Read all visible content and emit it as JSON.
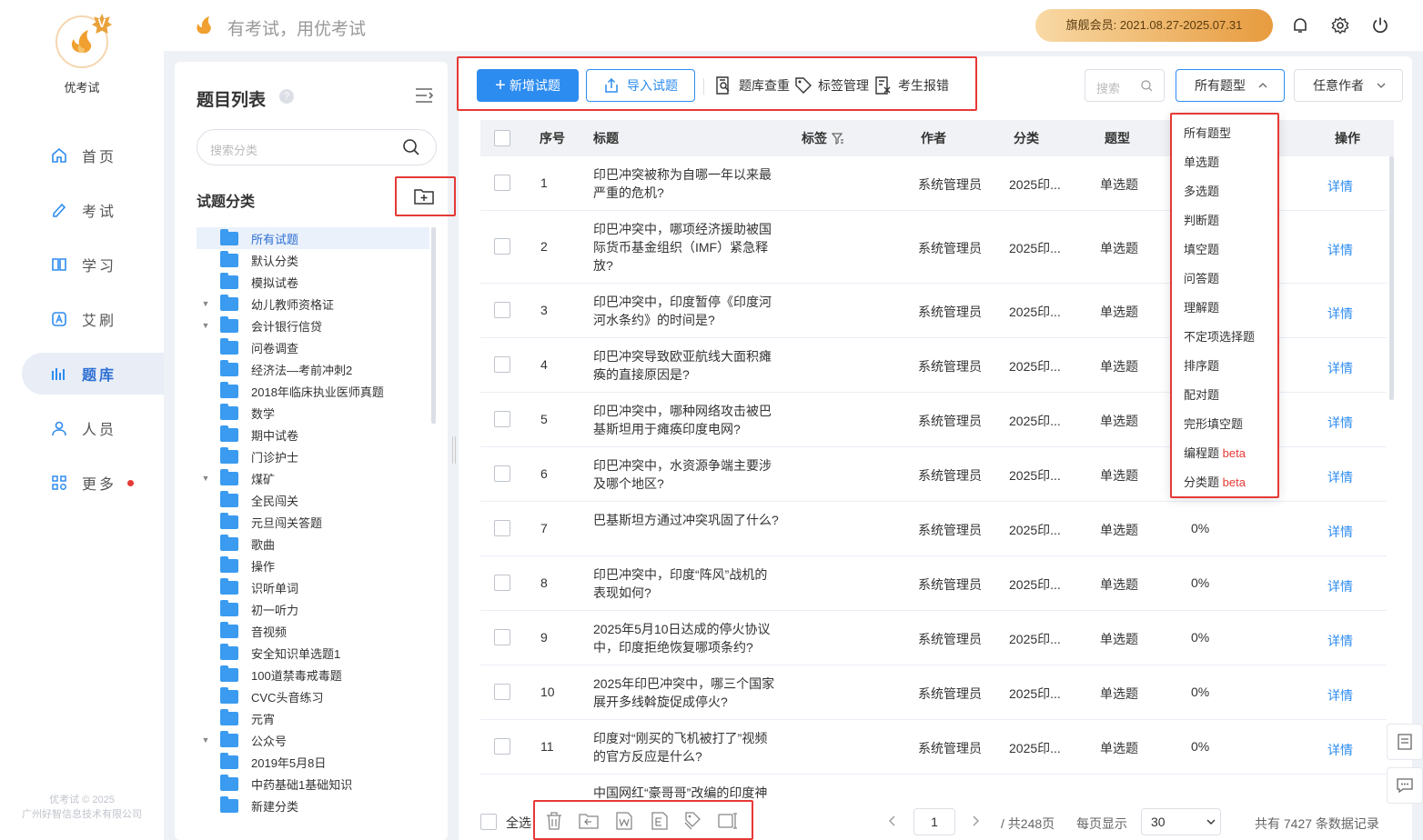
{
  "brand": {
    "name": "优考试",
    "slogan": "有考试，用优考试",
    "badge": "V"
  },
  "header": {
    "member_label": "旗舰会员:  2021.08.27-2025.07.31"
  },
  "nav": {
    "items": [
      {
        "label": "首页",
        "icon": "home-icon"
      },
      {
        "label": "考试",
        "icon": "exam-icon"
      },
      {
        "label": "学习",
        "icon": "book-icon"
      },
      {
        "label": "艾刷",
        "icon": "practice-icon"
      },
      {
        "label": "题库",
        "icon": "question-bank-icon",
        "active": true
      },
      {
        "label": "人员",
        "icon": "user-icon"
      },
      {
        "label": "更多",
        "icon": "more-icon"
      }
    ],
    "copyright_line1": "优考试 © 2025",
    "copyright_line2": "广州好智信息技术有限公司"
  },
  "sidebar": {
    "title": "题目列表",
    "help": "?",
    "search_placeholder": "搜索分类",
    "category_title": "试题分类",
    "tree": [
      {
        "label": "所有试题",
        "selected": true
      },
      {
        "label": "默认分类"
      },
      {
        "label": "模拟试卷"
      },
      {
        "label": "幼儿教师资格证",
        "expandable": true
      },
      {
        "label": "会计银行信贷",
        "expandable": true
      },
      {
        "label": "问卷调查"
      },
      {
        "label": "经济法—考前冲刺2"
      },
      {
        "label": "2018年临床执业医师真题"
      },
      {
        "label": "数学"
      },
      {
        "label": "期中试卷"
      },
      {
        "label": "门诊护士"
      },
      {
        "label": "煤矿",
        "expandable": true
      },
      {
        "label": "全民闯关"
      },
      {
        "label": "元旦闯关答题"
      },
      {
        "label": "歌曲"
      },
      {
        "label": "操作"
      },
      {
        "label": "识听单词"
      },
      {
        "label": "初一听力"
      },
      {
        "label": "音视频"
      },
      {
        "label": "安全知识单选题1"
      },
      {
        "label": "100道禁毒戒毒题"
      },
      {
        "label": "CVC头音练习"
      },
      {
        "label": "元宵"
      },
      {
        "label": "公众号",
        "expandable": true
      },
      {
        "label": "2019年5月8日"
      },
      {
        "label": "中药基础1基础知识"
      },
      {
        "label": "新建分类"
      }
    ]
  },
  "toolbar": {
    "add_label": "新增试题",
    "import_label": "导入试题",
    "dedupe_label": "题库查重",
    "tags_label": "标签管理",
    "errors_label": "考生报错",
    "search_placeholder": "搜索",
    "type_select": "所有题型",
    "author_select": "任意作者"
  },
  "table": {
    "headers": {
      "index": "序号",
      "title": "标题",
      "tags": "标签",
      "author": "作者",
      "category": "分类",
      "type": "题型",
      "action": "操作"
    },
    "rows": [
      {
        "index": "1",
        "title": "印巴冲突被称为自哪一年以来最严重的危机?",
        "author": "系统管理员",
        "category": "2025印...",
        "type": "单选题",
        "rate": "",
        "action": "详情"
      },
      {
        "index": "2",
        "title": "印巴冲突中，哪项经济援助被国际货币基金组织（IMF）紧急释放?",
        "author": "系统管理员",
        "category": "2025印...",
        "type": "单选题",
        "rate": "",
        "action": "详情"
      },
      {
        "index": "3",
        "title": "印巴冲突中，印度暂停《印度河河水条约》的时间是?",
        "author": "系统管理员",
        "category": "2025印...",
        "type": "单选题",
        "rate": "",
        "action": "详情"
      },
      {
        "index": "4",
        "title": "印巴冲突导致欧亚航线大面积瘫痪的直接原因是?",
        "author": "系统管理员",
        "category": "2025印...",
        "type": "单选题",
        "rate": "",
        "action": "详情"
      },
      {
        "index": "5",
        "title": "印巴冲突中，哪种网络攻击被巴基斯坦用于瘫痪印度电网?",
        "author": "系统管理员",
        "category": "2025印...",
        "type": "单选题",
        "rate": "",
        "action": "详情"
      },
      {
        "index": "6",
        "title": "印巴冲突中，水资源争端主要涉及哪个地区?",
        "author": "系统管理员",
        "category": "2025印...",
        "type": "单选题",
        "rate": "",
        "action": "详情"
      },
      {
        "index": "7",
        "title": "巴基斯坦方通过冲突巩固了什么?",
        "author": "系统管理员",
        "category": "2025印...",
        "type": "单选题",
        "rate": "0%",
        "action": "详情"
      },
      {
        "index": "8",
        "title": "印巴冲突中，印度“阵风”战机的表现如何?",
        "author": "系统管理员",
        "category": "2025印...",
        "type": "单选题",
        "rate": "0%",
        "action": "详情"
      },
      {
        "index": "9",
        "title": "2025年5月10日达成的停火协议中，印度拒绝恢复哪项条约?",
        "author": "系统管理员",
        "category": "2025印...",
        "type": "单选题",
        "rate": "0%",
        "action": "详情"
      },
      {
        "index": "10",
        "title": "2025年印巴冲突中，哪三个国家展开多线斡旋促成停火?",
        "author": "系统管理员",
        "category": "2025印...",
        "type": "单选题",
        "rate": "0%",
        "action": "详情"
      },
      {
        "index": "11",
        "title": "印度对“刚买的飞机被打了”视频的官方反应是什么?",
        "author": "系统管理员",
        "category": "2025印...",
        "type": "单选题",
        "rate": "0%",
        "action": "详情"
      },
      {
        "index": "",
        "title": "中国网红“豪哥哥”改编的印度神",
        "author": "",
        "category": "",
        "type": "",
        "rate": "",
        "action": ""
      }
    ]
  },
  "type_dropdown": {
    "options": [
      "所有题型",
      "单选题",
      "多选题",
      "判断题",
      "填空题",
      "问答题",
      "理解题",
      "不定项选择题",
      "排序题",
      "配对题",
      "完形填空题",
      "编程题",
      "分类题"
    ],
    "beta_label": "beta",
    "beta_options": [
      "编程题",
      "分类题"
    ]
  },
  "footer": {
    "select_all": "全选",
    "page": "1",
    "total_pages": "/ 共248页",
    "per_page_label": "每页显示",
    "per_page": "30",
    "total_records": "共有 7427 条数据记录"
  },
  "colors": {
    "primary": "#2d8cf0",
    "highlight": "#e53935",
    "brand": "#e9a23b"
  }
}
